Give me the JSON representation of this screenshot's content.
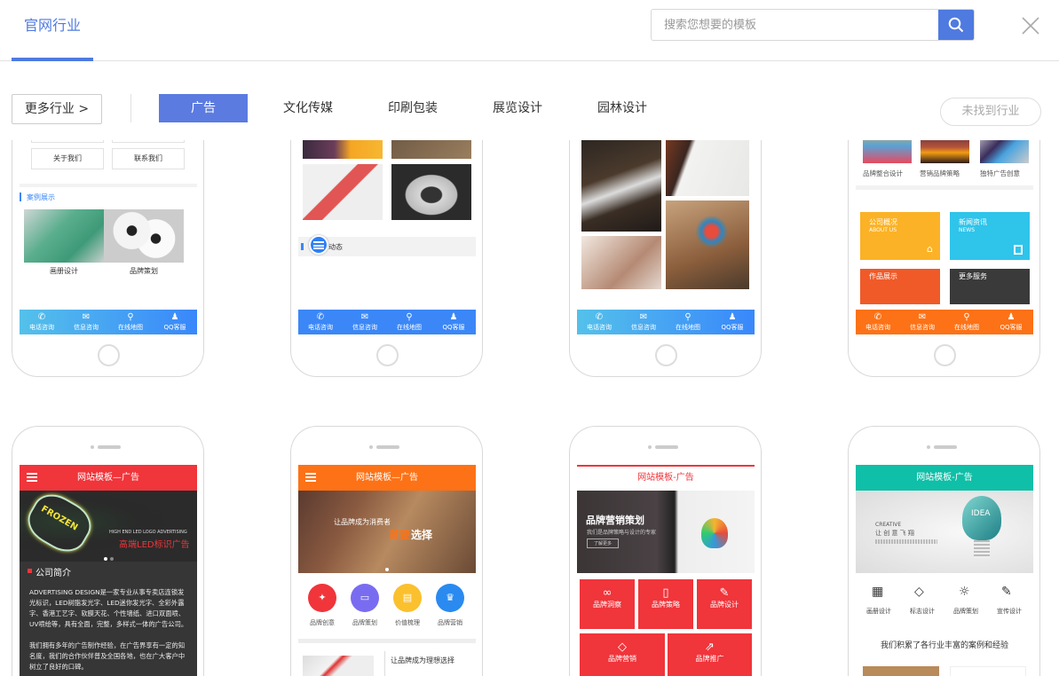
{
  "header": {
    "tab": "官网行业",
    "search_placeholder": "搜索您想要的模板",
    "search_icon": "search-icon",
    "close_icon": "close-icon"
  },
  "filters": {
    "more": "更多行业 >",
    "industries": [
      "广告",
      "文化传媒",
      "印刷包装",
      "展览设计",
      "园林设计"
    ],
    "active": "广告",
    "not_found": "未找到行业"
  },
  "bottom_bar": [
    {
      "icon": "phone-icon",
      "label": "电话咨询"
    },
    {
      "icon": "mail-icon",
      "label": "信息咨询"
    },
    {
      "icon": "map-pin-icon",
      "label": "在线地图"
    },
    {
      "icon": "qq-icon",
      "label": "QQ客服"
    }
  ],
  "colors": {
    "accent": "#4f7ae0",
    "red": "#f0353b",
    "orange": "#fd7216",
    "teal": "#0fbfa7",
    "blue": "#3b87f7"
  },
  "templates": [
    {
      "buttons": [
        "关于我们",
        "联系我们"
      ],
      "section": "案例展示",
      "cases": [
        "画册设计",
        "品牌策划"
      ]
    },
    {
      "section": "动态"
    },
    {},
    {
      "features": [
        "品牌整合设计",
        "营销品牌策略",
        "独特广告创意"
      ],
      "tiles": [
        {
          "title": "公司概况",
          "sub": "ABOUT US"
        },
        {
          "title": "新闻资讯",
          "sub": "NEWS"
        },
        {
          "title": "作品展示"
        },
        {
          "title": "更多服务"
        }
      ]
    },
    {
      "title": "网站模板—广告",
      "banner_en": "HIGH END LED LOGO ADVERTISING",
      "banner_cn": "高端LED标识广告",
      "section": "公司简介",
      "para1": "ADVERTISING DESIGN是一家专业从事专卖店连锁发光标识，LED树脂发光字、LED迷你发光字、全彩外露字、香港工艺字、软膜天花、个性墙纸、进口双面喷、UV喷绘等，具有全面，完整，多样式一体的广告公司。",
      "para2": "我们拥有多年的广告制作经验，在广告界享有一定的知名度，我们的合作伙伴普及全国各地，也在广大客户中树立了良好的口碑。"
    },
    {
      "title": "网站模板—广告",
      "banner1": "让品牌成为消费者",
      "banner2a": "首要",
      "banner2b": "选择",
      "icons": [
        "品牌创意",
        "品牌策划",
        "价值梳理",
        "品牌营销"
      ],
      "article": "让品牌成为理想选择"
    },
    {
      "title": "网站模板-广告",
      "banner": "品牌营销策划",
      "banner_sub": "我们是品牌策略与设计的专家",
      "banner_btn": "了解更多",
      "tiles": [
        "品牌洞察",
        "品牌策略",
        "品牌设计",
        "品牌营销",
        "品牌推广"
      ]
    },
    {
      "title": "网站模板-广告",
      "banner_en": "CREATIVE",
      "banner_cn": "让 创 意 飞 翔",
      "bulb": "IDEA",
      "icons": [
        "画册设计",
        "标志设计",
        "品牌策划",
        "宣传设计"
      ],
      "slogan": "我们积累了各行业丰富的案例和经验"
    }
  ]
}
